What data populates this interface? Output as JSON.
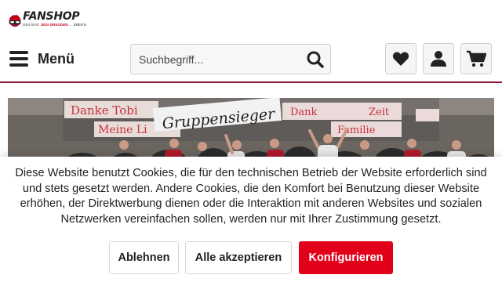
{
  "logo": {
    "name": "FANSHOP",
    "tagline_pre": "DES EHC ",
    "tagline_red": "JEDI DRESDEN",
    "tagline_post": " ... EBERN",
    "colors": {
      "red": "#d0021b",
      "dark": "#222222"
    }
  },
  "header": {
    "menu_label": "Menü",
    "menu_icon": "hamburger-icon",
    "search": {
      "placeholder": "Suchbegriff...",
      "value": "",
      "icon": "search-icon"
    },
    "actions": [
      {
        "name": "wishlist",
        "icon": "heart-icon"
      },
      {
        "name": "account",
        "icon": "user-icon"
      },
      {
        "name": "cart",
        "icon": "cart-icon"
      }
    ],
    "accent_rule_color": "#8a1a34"
  },
  "banner": {
    "image": "fan-group-photo",
    "banner_texts": [
      "Danke Tobi",
      "Gruppensieger",
      "Meine Li",
      "Dank",
      "Familie",
      "Zeit"
    ]
  },
  "cookie_notice": {
    "text": "Diese Website benutzt Cookies, die für den technischen Betrieb der Website erforderlich sind und stets gesetzt werden. Andere Cookies, die den Komfort bei Benutzung dieser Website erhöhen, der Direktwerbung dienen oder die Interaktion mit anderen Websites und sozialen Netzwerken vereinfachen sollen, werden nur mit Ihrer Zustimmung gesetzt.",
    "buttons": {
      "decline": "Ablehnen",
      "accept_all": "Alle akzeptieren",
      "configure": "Konfigurieren"
    },
    "primary_color": "#e3001b"
  }
}
